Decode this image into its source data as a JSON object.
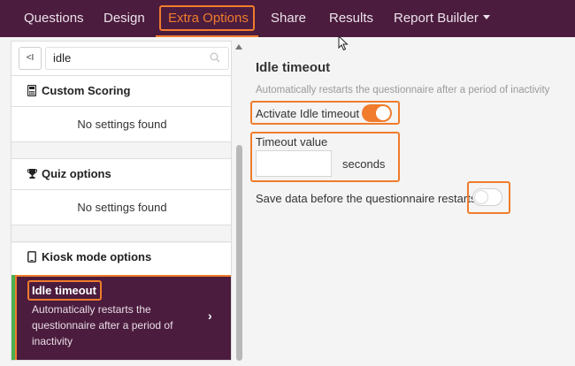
{
  "nav": {
    "items": [
      {
        "label": "Questions"
      },
      {
        "label": "Design"
      },
      {
        "label": "Extra Options"
      },
      {
        "label": "Share"
      },
      {
        "label": "Results"
      },
      {
        "label": "Report Builder"
      }
    ],
    "active_index": 2
  },
  "sidebar": {
    "collapse_label": "<I",
    "search_value": "idle",
    "sections": [
      {
        "title": "Custom Scoring",
        "icon": "calculator-icon",
        "empty_text": "No settings found"
      },
      {
        "title": "Quiz options",
        "icon": "trophy-icon",
        "empty_text": "No settings found"
      },
      {
        "title": "Kiosk mode options",
        "icon": "tablet-icon"
      }
    ],
    "selected_item": {
      "title": "Idle timeout",
      "description": "Automatically restarts the questionnaire after a period of inactivity"
    }
  },
  "settings": {
    "title": "Idle timeout",
    "description": "Automatically restarts the questionnaire after a period of inactivity",
    "activate_label": "Activate Idle timeout",
    "activate_on": true,
    "timeout_label": "Timeout value",
    "timeout_value": "",
    "timeout_unit": "seconds",
    "save_label": "Save data before the questionnaire restarts",
    "save_on": false
  },
  "colors": {
    "nav_bg": "#4b1c3e",
    "accent": "#f07c2c",
    "selected_border": "#4caf50"
  }
}
